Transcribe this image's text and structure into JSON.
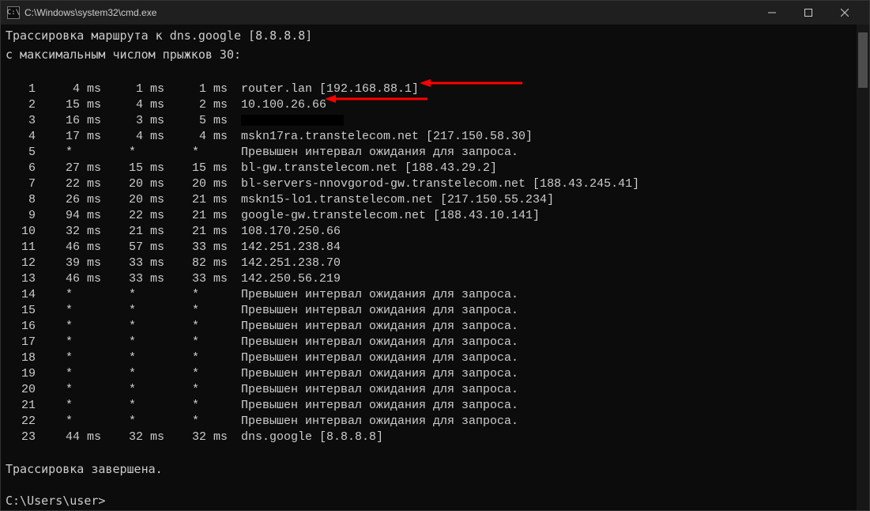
{
  "window": {
    "icon_text": "C:\\",
    "title": "C:\\Windows\\system32\\cmd.exe"
  },
  "header": {
    "line1": "Трассировка маршрута к dns.google [8.8.8.8]",
    "line2": "с максимальным числом прыжков 30:"
  },
  "timeout_text": "Превышен интервал ожидания для запроса.",
  "hops": [
    {
      "n": "1",
      "t1": "4 ms",
      "t2": "1 ms",
      "t3": "1 ms",
      "host": "router.lan [192.168.88.1]",
      "arrow": true
    },
    {
      "n": "2",
      "t1": "15 ms",
      "t2": "4 ms",
      "t3": "2 ms",
      "host": "10.100.26.66",
      "arrow": true
    },
    {
      "n": "3",
      "t1": "16 ms",
      "t2": "3 ms",
      "t3": "5 ms",
      "host": "",
      "redacted": true
    },
    {
      "n": "4",
      "t1": "17 ms",
      "t2": "4 ms",
      "t3": "4 ms",
      "host": "mskn17ra.transtelecom.net [217.150.58.30]"
    },
    {
      "n": "5",
      "t1": "*",
      "t2": "*",
      "t3": "*",
      "host": "@timeout",
      "star": true
    },
    {
      "n": "6",
      "t1": "27 ms",
      "t2": "15 ms",
      "t3": "15 ms",
      "host": "bl-gw.transtelecom.net [188.43.29.2]"
    },
    {
      "n": "7",
      "t1": "22 ms",
      "t2": "20 ms",
      "t3": "20 ms",
      "host": "bl-servers-nnovgorod-gw.transtelecom.net [188.43.245.41]"
    },
    {
      "n": "8",
      "t1": "26 ms",
      "t2": "20 ms",
      "t3": "21 ms",
      "host": "mskn15-lo1.transtelecom.net [217.150.55.234]"
    },
    {
      "n": "9",
      "t1": "94 ms",
      "t2": "22 ms",
      "t3": "21 ms",
      "host": "google-gw.transtelecom.net [188.43.10.141]"
    },
    {
      "n": "10",
      "t1": "32 ms",
      "t2": "21 ms",
      "t3": "21 ms",
      "host": "108.170.250.66"
    },
    {
      "n": "11",
      "t1": "46 ms",
      "t2": "57 ms",
      "t3": "33 ms",
      "host": "142.251.238.84"
    },
    {
      "n": "12",
      "t1": "39 ms",
      "t2": "33 ms",
      "t3": "82 ms",
      "host": "142.251.238.70"
    },
    {
      "n": "13",
      "t1": "46 ms",
      "t2": "33 ms",
      "t3": "33 ms",
      "host": "142.250.56.219"
    },
    {
      "n": "14",
      "t1": "*",
      "t2": "*",
      "t3": "*",
      "host": "@timeout",
      "star": true
    },
    {
      "n": "15",
      "t1": "*",
      "t2": "*",
      "t3": "*",
      "host": "@timeout",
      "star": true
    },
    {
      "n": "16",
      "t1": "*",
      "t2": "*",
      "t3": "*",
      "host": "@timeout",
      "star": true
    },
    {
      "n": "17",
      "t1": "*",
      "t2": "*",
      "t3": "*",
      "host": "@timeout",
      "star": true
    },
    {
      "n": "18",
      "t1": "*",
      "t2": "*",
      "t3": "*",
      "host": "@timeout",
      "star": true
    },
    {
      "n": "19",
      "t1": "*",
      "t2": "*",
      "t3": "*",
      "host": "@timeout",
      "star": true
    },
    {
      "n": "20",
      "t1": "*",
      "t2": "*",
      "t3": "*",
      "host": "@timeout",
      "star": true
    },
    {
      "n": "21",
      "t1": "*",
      "t2": "*",
      "t3": "*",
      "host": "@timeout",
      "star": true
    },
    {
      "n": "22",
      "t1": "*",
      "t2": "*",
      "t3": "*",
      "host": "@timeout",
      "star": true
    },
    {
      "n": "23",
      "t1": "44 ms",
      "t2": "32 ms",
      "t3": "32 ms",
      "host": "dns.google [8.8.8.8]"
    }
  ],
  "footer": {
    "done": "Трассировка завершена.",
    "prompt": "C:\\Users\\user>"
  },
  "arrow_color": "#ff0000"
}
